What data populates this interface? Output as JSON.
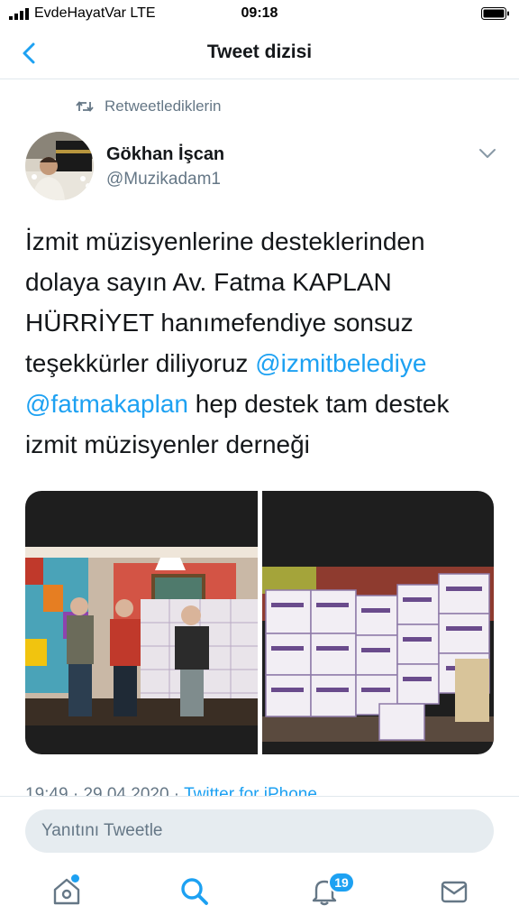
{
  "status_bar": {
    "carrier": "EvdeHayatVar  LTE",
    "time": "09:18"
  },
  "header": {
    "title": "Tweet dizisi"
  },
  "retweet_context": {
    "label": "Retweetlediklerin"
  },
  "tweet": {
    "author_name": "Gökhan İşcan",
    "author_handle": "@Muzikadam1",
    "text_part1": "İzmit müzisyenlerine desteklerinden dolaya sayın Av. Fatma KAPLAN HÜRRİYET hanımefendiye sonsuz teşekkürler diliyoruz ",
    "mention1": "@izmitbelediye",
    "mention2": "@fatmakaplan",
    "text_part2": " hep destek tam destek izmit müzisyenler derneği",
    "time": "19:49",
    "date": "29.04.2020",
    "source": "Twitter for iPhone"
  },
  "reply_bar": {
    "placeholder": "Yanıtını Tweetle"
  },
  "tab_bar": {
    "notifications_count": "19"
  },
  "colors": {
    "accent": "#1da1f2",
    "secondary_text": "#657786",
    "primary_text": "#14171a"
  },
  "icons": [
    "signal-icon",
    "battery-icon",
    "back-arrow-icon",
    "retweet-icon",
    "chevron-down-icon",
    "home-icon",
    "search-icon",
    "bell-icon",
    "mail-icon"
  ]
}
